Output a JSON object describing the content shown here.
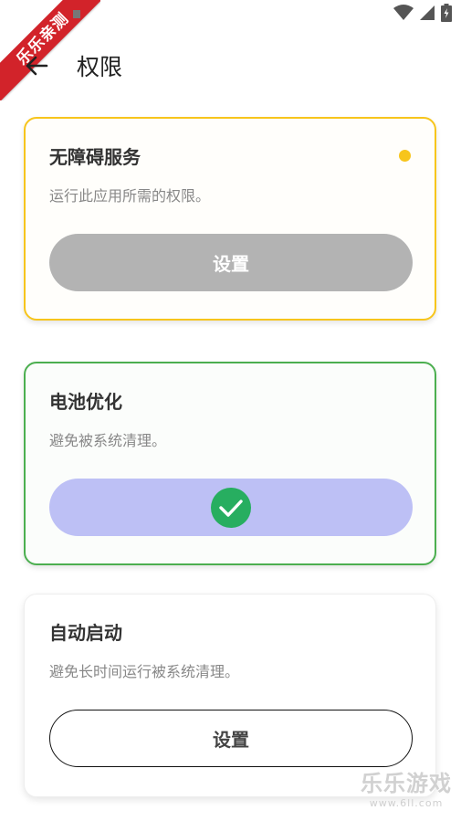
{
  "status_bar": {
    "ribbon_text": "乐乐亲测"
  },
  "app_bar": {
    "title": "权限"
  },
  "cards": [
    {
      "title": "无障碍服务",
      "description": "运行此应用所需的权限。",
      "button_label": "设置",
      "status": "pending",
      "status_color": "#f7c51c"
    },
    {
      "title": "电池优化",
      "description": "避免被系统清理。",
      "button_label": "",
      "status": "granted",
      "status_color": "#4caf50",
      "button_icon": "check-circle-icon"
    },
    {
      "title": "自动启动",
      "description": "避免长时间运行被系统清理。",
      "button_label": "设置",
      "status": "unset"
    }
  ],
  "watermark": {
    "main": "乐乐游戏",
    "sub": "www.6ll.com"
  },
  "colors": {
    "accent_yellow": "#f7c51c",
    "accent_green": "#4caf50",
    "button_gray": "#b3b3b3",
    "button_purple": "#bdc0f5",
    "check_green": "#27ae60"
  }
}
